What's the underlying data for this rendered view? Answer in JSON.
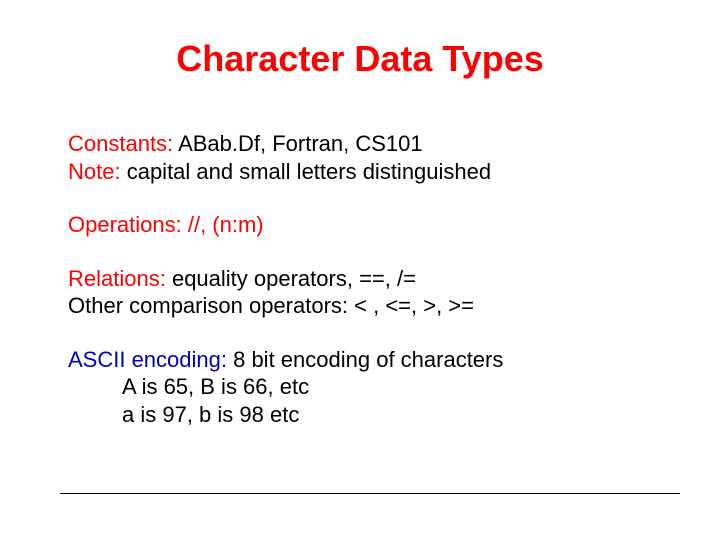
{
  "title": "Character Data Types",
  "constants": {
    "label": "Constants:",
    "values": "  ABab.Df, Fortran, CS101",
    "note_label": "Note:",
    "note_text": " capital and small letters distinguished"
  },
  "operations": {
    "label": "Operations:",
    "ops": " //, (n:m)"
  },
  "relations": {
    "label": "Relations:",
    "text": "  equality operators, ==, /=",
    "other": "Other comparison operators:   < , <=, >, >="
  },
  "ascii": {
    "label": "ASCII encoding:",
    "text": "  8 bit encoding of characters",
    "lineA": "A is 65, B is 66, etc",
    "linea": "a is 97, b is 98 etc"
  }
}
